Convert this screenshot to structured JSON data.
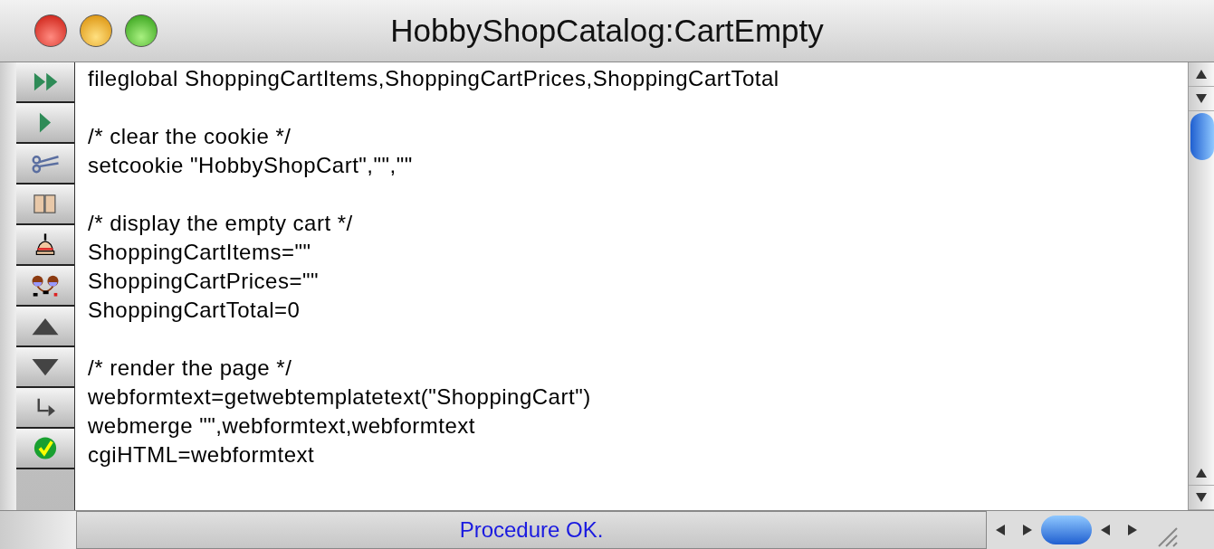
{
  "window": {
    "title": "HobbyShopCatalog:CartEmpty"
  },
  "toolbar": [
    {
      "kind": "run-all"
    },
    {
      "kind": "run"
    },
    {
      "kind": "cut"
    },
    {
      "kind": "tiles"
    },
    {
      "kind": "stamp"
    },
    {
      "kind": "network"
    },
    {
      "kind": "up"
    },
    {
      "kind": "down"
    },
    {
      "kind": "step"
    },
    {
      "kind": "check"
    }
  ],
  "code_blocks": [
    [
      "fileglobal ShoppingCartItems,ShoppingCartPrices,ShoppingCartTotal"
    ],
    [
      "/* clear the cookie */",
      "setcookie \"HobbyShopCart\",\"\",\"\""
    ],
    [
      "/* display the empty cart */",
      "ShoppingCartItems=\"\"",
      "ShoppingCartPrices=\"\"",
      "ShoppingCartTotal=0"
    ],
    [
      "/* render the page */",
      "webformtext=getwebtemplatetext(\"ShoppingCart\")",
      "webmerge \"\",webformtext,webformtext",
      "cgiHTML=webformtext"
    ]
  ],
  "status_bar": {
    "message": "Procedure OK."
  }
}
